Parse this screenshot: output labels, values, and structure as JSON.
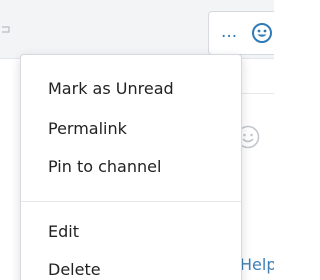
{
  "toolbar": {
    "more_label": "...",
    "emoji_icon": "emoji-smile-icon",
    "strip_icon": "reply-arrow-icon"
  },
  "menu": {
    "items": [
      {
        "label": "Mark as Unread"
      },
      {
        "label": "Permalink"
      },
      {
        "label": "Pin to channel"
      },
      {
        "label": "Edit"
      },
      {
        "label": "Delete"
      }
    ]
  },
  "background": {
    "help_label": "Help",
    "emoji_icon": "emoji-smile-icon"
  },
  "colors": {
    "accent": "#2f7bb7",
    "menu_text": "#222222",
    "border": "#d6d9de"
  }
}
